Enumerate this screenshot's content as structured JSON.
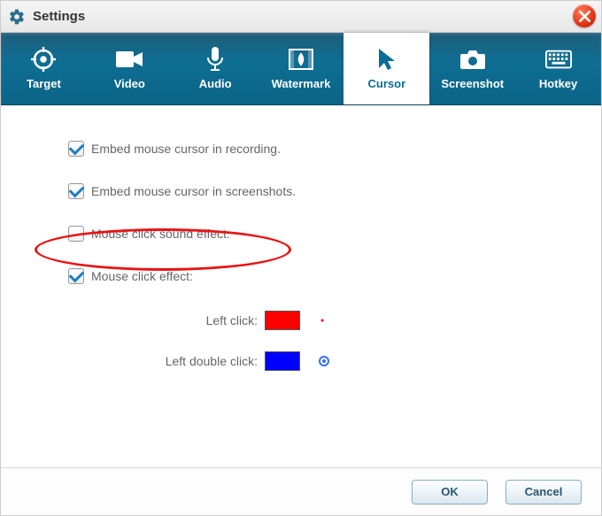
{
  "window": {
    "title": "Settings"
  },
  "tabs": {
    "target": "Target",
    "video": "Video",
    "audio": "Audio",
    "watermark": "Watermark",
    "cursor": "Cursor",
    "screenshot": "Screenshot",
    "hotkey": "Hotkey",
    "active": "Cursor"
  },
  "options": {
    "embed_record": {
      "label": "Embed mouse cursor in recording.",
      "checked": true
    },
    "embed_screenshot": {
      "label": "Embed mouse cursor in screenshots.",
      "checked": true
    },
    "click_sound": {
      "label": "Mouse click sound effect.",
      "checked": false
    },
    "click_effect": {
      "label": "Mouse click effect:",
      "checked": true
    }
  },
  "colors": {
    "left_click": {
      "label": "Left click:",
      "color": "#ff0000"
    },
    "left_double": {
      "label": "Left double click:",
      "color": "#0000ff"
    }
  },
  "buttons": {
    "ok": "OK",
    "cancel": "Cancel"
  }
}
